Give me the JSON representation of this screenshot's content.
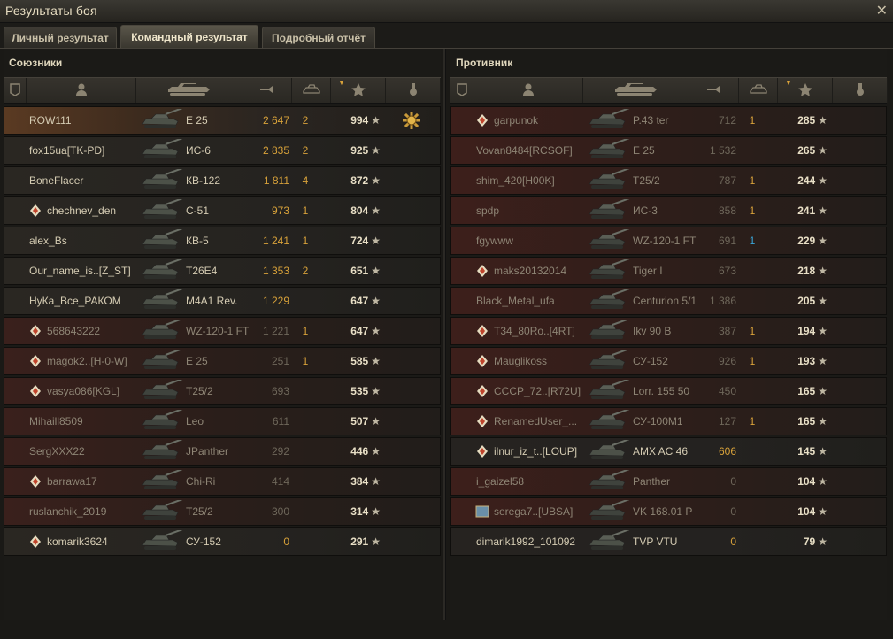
{
  "window": {
    "title": "Результаты боя",
    "close_glyph": "✕"
  },
  "tabs": [
    {
      "label": "Личный результат",
      "active": false
    },
    {
      "label": "Командный результат",
      "active": true
    },
    {
      "label": "Подробный отчёт",
      "active": false
    }
  ],
  "colors": {
    "accent": "#d8a23a",
    "kill_blue": "#3aa6d8",
    "text": "#d5ccb3",
    "dim_text": "#8e8575"
  },
  "allies": {
    "title": "Союзники",
    "columns": [
      "rank-icon",
      "player-icon",
      "tank-icon",
      "damage-icon",
      "kills-icon",
      "xp-star-icon",
      "medal-icon"
    ],
    "rows": [
      {
        "name": "ROW111",
        "vehicle": "E 25",
        "damage": "2 647",
        "kills": "2",
        "xp": "994",
        "state": "me",
        "platoon": false,
        "medal": true
      },
      {
        "name": "fox15ua[TK-PD]",
        "vehicle": "ИС-6",
        "damage": "2 835",
        "kills": "2",
        "xp": "925",
        "state": "alive",
        "platoon": false
      },
      {
        "name": "BoneFlacer",
        "vehicle": "КВ-122",
        "damage": "1 811",
        "kills": "4",
        "xp": "872",
        "state": "alive",
        "platoon": false
      },
      {
        "name": "chechnev_den",
        "vehicle": "С-51",
        "damage": "973",
        "kills": "1",
        "xp": "804",
        "state": "alive",
        "platoon": true
      },
      {
        "name": "alex_Bs",
        "vehicle": "КВ-5",
        "damage": "1 241",
        "kills": "1",
        "xp": "724",
        "state": "alive",
        "platoon": false
      },
      {
        "name": "Our_name_is..[Z_ST]",
        "vehicle": "T26E4",
        "damage": "1 353",
        "kills": "2",
        "xp": "651",
        "state": "alive",
        "platoon": false
      },
      {
        "name": "НуКа_Все_РАКОМ",
        "vehicle": "M4A1 Rev.",
        "damage": "1 229",
        "kills": "",
        "xp": "647",
        "state": "alive",
        "platoon": false
      },
      {
        "name": "568643222",
        "vehicle": "WZ-120-1 FT",
        "damage": "1 221",
        "kills": "1",
        "xp": "647",
        "state": "dead",
        "platoon": true
      },
      {
        "name": "magok2..[H-0-W]",
        "vehicle": "E 25",
        "damage": "251",
        "kills": "1",
        "xp": "585",
        "state": "dead",
        "platoon": true
      },
      {
        "name": "vasya086[KGL]",
        "vehicle": "T25/2",
        "damage": "693",
        "kills": "",
        "xp": "535",
        "state": "dead",
        "platoon": true
      },
      {
        "name": "Mihaill8509",
        "vehicle": "Leo",
        "damage": "611",
        "kills": "",
        "xp": "507",
        "state": "dead",
        "platoon": false
      },
      {
        "name": "SergXXX22",
        "vehicle": "JPanther",
        "damage": "292",
        "kills": "",
        "xp": "446",
        "state": "dead",
        "platoon": false
      },
      {
        "name": "barrawa17",
        "vehicle": "Chi-Ri",
        "damage": "414",
        "kills": "",
        "xp": "384",
        "state": "dead",
        "platoon": true
      },
      {
        "name": "ruslanchik_2019",
        "vehicle": "T25/2",
        "damage": "300",
        "kills": "",
        "xp": "314",
        "state": "dead",
        "platoon": false
      },
      {
        "name": "komarik3624",
        "vehicle": "СУ-152",
        "damage": "0",
        "kills": "",
        "xp": "291",
        "state": "alive",
        "platoon": true
      }
    ]
  },
  "enemies": {
    "title": "Противник",
    "rows": [
      {
        "name": "garpunok",
        "vehicle": "P.43 ter",
        "damage": "712",
        "kills": "1",
        "xp": "285",
        "state": "dead",
        "platoon": true
      },
      {
        "name": "Vovan8484[RCSOF]",
        "vehicle": "E 25",
        "damage": "1 532",
        "kills": "",
        "xp": "265",
        "state": "dead",
        "platoon": false
      },
      {
        "name": "shim_420[H00K]",
        "vehicle": "T25/2",
        "damage": "787",
        "kills": "1",
        "xp": "244",
        "state": "dead",
        "platoon": false
      },
      {
        "name": "spdp",
        "vehicle": "ИС-3",
        "damage": "858",
        "kills": "1",
        "xp": "241",
        "state": "dead",
        "platoon": false
      },
      {
        "name": "fgywww",
        "vehicle": "WZ-120-1 FT",
        "damage": "691",
        "kills": "1",
        "xp": "229",
        "state": "dead",
        "platoon": false,
        "kill_blue": true
      },
      {
        "name": "maks20132014",
        "vehicle": "Tiger I",
        "damage": "673",
        "kills": "",
        "xp": "218",
        "state": "dead",
        "platoon": true
      },
      {
        "name": "Black_Metal_ufa",
        "vehicle": "Centurion 5/1",
        "damage": "1 386",
        "kills": "",
        "xp": "205",
        "state": "dead",
        "platoon": false
      },
      {
        "name": "T34_80Ro..[4RT]",
        "vehicle": "Ikv 90 B",
        "damage": "387",
        "kills": "1",
        "xp": "194",
        "state": "dead",
        "platoon": true
      },
      {
        "name": "Mauglikoss",
        "vehicle": "СУ-152",
        "damage": "926",
        "kills": "1",
        "xp": "193",
        "state": "dead",
        "platoon": true
      },
      {
        "name": "СССР_72..[R72U]",
        "vehicle": "Lorr. 155 50",
        "damage": "450",
        "kills": "",
        "xp": "165",
        "state": "dead",
        "platoon": true
      },
      {
        "name": "RenamedUser_...",
        "vehicle": "СУ-100М1",
        "damage": "127",
        "kills": "1",
        "xp": "165",
        "state": "dead",
        "platoon": true
      },
      {
        "name": "ilnur_iz_t..[LOUP]",
        "vehicle": "AMX AC 46",
        "damage": "606",
        "kills": "",
        "xp": "145",
        "state": "alive",
        "platoon": true
      },
      {
        "name": "i_gaizel58",
        "vehicle": "Panther",
        "damage": "0",
        "kills": "",
        "xp": "104",
        "state": "dead",
        "platoon": false
      },
      {
        "name": "serega7..[UBSA]",
        "vehicle": "VK 168.01 P",
        "damage": "0",
        "kills": "",
        "xp": "104",
        "state": "dead",
        "platoon": false,
        "clan_badge": true
      },
      {
        "name": "dimarik1992_101092",
        "vehicle": "TVP VTU",
        "damage": "0",
        "kills": "",
        "xp": "79",
        "state": "alive",
        "platoon": false
      }
    ]
  }
}
